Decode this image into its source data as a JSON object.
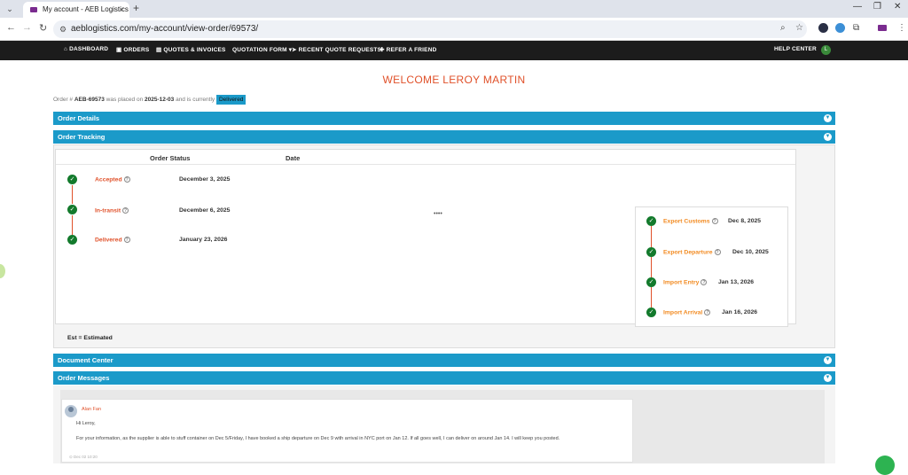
{
  "browser": {
    "tab_title": "My account - AEB Logistics",
    "tab_close": "×",
    "new_tab": "+",
    "url": "aeblogistics.com/my-account/view-order/69573/"
  },
  "site_nav": {
    "items": [
      "DASHBOARD",
      "ORDERS",
      "QUOTES & INVOICES",
      "QUOTATION FORM ▾",
      "RECENT QUOTE REQUESTS",
      "REFER A FRIEND"
    ],
    "help": "HELP CENTER",
    "user_initial": "L"
  },
  "welcome": "WELCOME LEROY MARTIN",
  "order_summary": {
    "prefix": "Order #",
    "order_number": "AEB-69573",
    "placed_text": "was placed on",
    "placed_date": "2025-12-03",
    "status_text": "and is currently",
    "status": "Delivered"
  },
  "sections": {
    "order_details": "Order Details",
    "order_tracking": "Order Tracking",
    "document_center": "Document Center",
    "order_messages": "Order Messages"
  },
  "tracking": {
    "col_status": "Order Status",
    "col_date": "Date",
    "steps": [
      {
        "label": "Accepted",
        "date": "December 3, 2025"
      },
      {
        "label": "In-transit",
        "date": "December 6, 2025"
      },
      {
        "label": "Delivered",
        "date": "January 23, 2026"
      }
    ],
    "dots": "••••",
    "sub_steps": [
      {
        "label": "Export Customs",
        "date": "Dec 8, 2025"
      },
      {
        "label": "Export Departure",
        "date": "Dec 10, 2025"
      },
      {
        "label": "Import Entry",
        "date": "Jan 13, 2026"
      },
      {
        "label": "Import Arrival",
        "date": "Jan 16, 2026"
      }
    ],
    "est_note": "Est = Estimated"
  },
  "message": {
    "author": "Alan Fan",
    "greeting": "Hi Leroy,",
    "body": "For your information, as the supplier is able to stuff container on Dec 5/Friday, I have booked a ship departure on Dec 9 with arrival in NYC port on Jan 12. If all goes well, I can deliver on around Jan 14. I will keep you posted.",
    "time": "Dec 02 10:20"
  },
  "colors": {
    "accent_blue": "#1b9ac9",
    "accent_orange": "#e0512a",
    "check_green": "#137a2c",
    "sub_orange": "#f28a20"
  }
}
